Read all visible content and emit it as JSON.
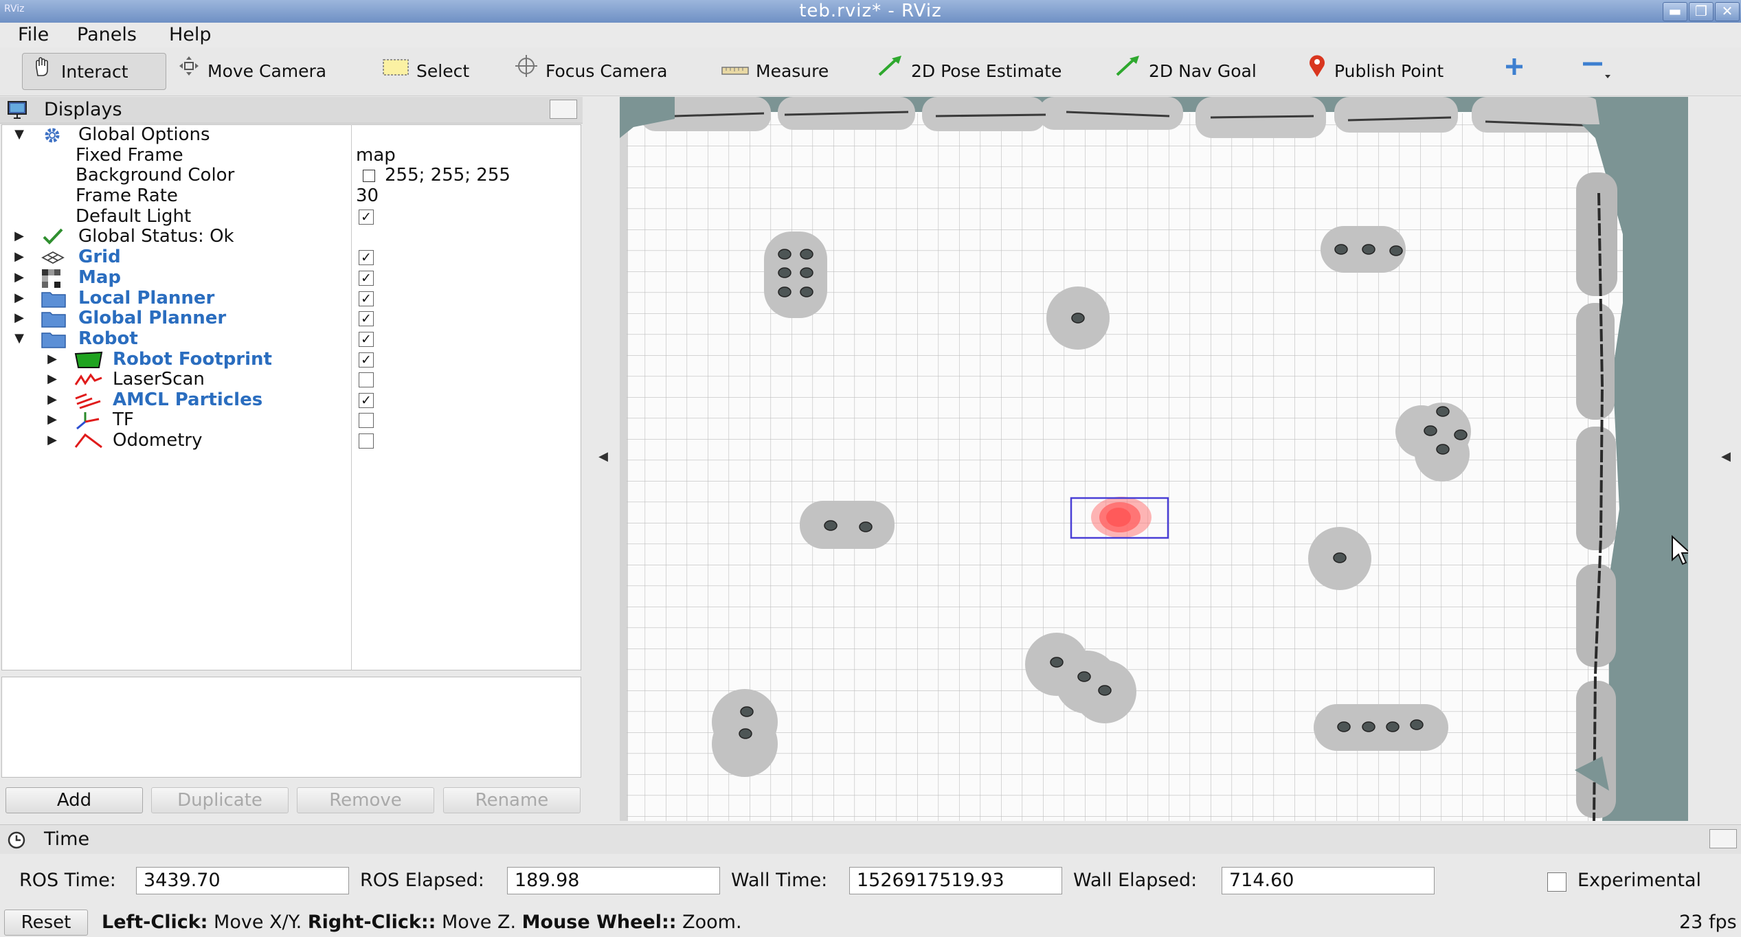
{
  "window": {
    "app_icon": "RViz",
    "title": "teb.rviz* - RViz"
  },
  "menu": {
    "file": "File",
    "panels": "Panels",
    "help": "Help"
  },
  "toolbar": {
    "interact": "Interact",
    "move_camera": "Move Camera",
    "select": "Select",
    "focus_camera": "Focus Camera",
    "measure": "Measure",
    "pose_estimate": "2D Pose Estimate",
    "nav_goal": "2D Nav Goal",
    "publish_point": "Publish Point"
  },
  "displays": {
    "title": "Displays",
    "rows": [
      {
        "label": "Global Options",
        "value": ""
      },
      {
        "label": "Fixed Frame",
        "value": "map"
      },
      {
        "label": "Background Color",
        "value": "255; 255; 255"
      },
      {
        "label": "Frame Rate",
        "value": "30"
      },
      {
        "label": "Default Light",
        "value": ""
      },
      {
        "label": "Global Status: Ok",
        "value": ""
      },
      {
        "label": "Grid",
        "checked": true
      },
      {
        "label": "Map",
        "checked": true
      },
      {
        "label": "Local Planner",
        "checked": true
      },
      {
        "label": "Global Planner",
        "checked": true
      },
      {
        "label": "Robot",
        "checked": true
      },
      {
        "label": "Robot Footprint",
        "checked": true
      },
      {
        "label": "LaserScan",
        "checked": false
      },
      {
        "label": "AMCL Particles",
        "checked": true
      },
      {
        "label": "TF",
        "checked": false
      },
      {
        "label": "Odometry",
        "checked": false
      }
    ],
    "default_light_checked": true,
    "buttons": {
      "add": "Add",
      "duplicate": "Duplicate",
      "remove": "Remove",
      "rename": "Rename"
    }
  },
  "time": {
    "title": "Time",
    "ros_time_label": "ROS Time:",
    "ros_time": "3439.70",
    "ros_elapsed_label": "ROS Elapsed:",
    "ros_elapsed": "189.98",
    "wall_time_label": "Wall Time:",
    "wall_time": "1526917519.93",
    "wall_elapsed_label": "Wall Elapsed:",
    "wall_elapsed": "714.60",
    "experimental": "Experimental"
  },
  "status": {
    "reset": "Reset",
    "left_click": "Left-Click:",
    "left_click_action": " Move X/Y. ",
    "right_click": "Right-Click::",
    "right_click_action": " Move Z. ",
    "wheel": "Mouse Wheel::",
    "wheel_action": " Zoom.",
    "fps": "23 fps"
  },
  "colors": {
    "link_blue": "#2a6dbf",
    "map_wall": "#6f8d8d",
    "inflation": "#c2c2c2",
    "particles": "#ff6f6f",
    "footprint": "#4a3fd6"
  }
}
